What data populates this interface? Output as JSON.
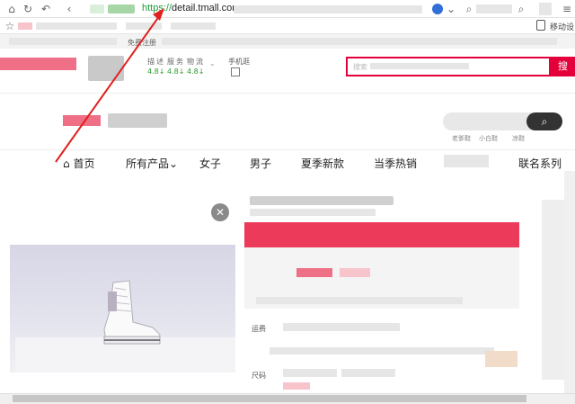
{
  "browser": {
    "url_scheme": "https://",
    "url_host": "detail.tmall.com",
    "bookmark_text": "免费注册",
    "mobile_device_label": "移动设构"
  },
  "header": {
    "rating_labels": [
      "描",
      "述",
      "服",
      "务",
      "物",
      "流"
    ],
    "ratings": [
      "4.8↓",
      "4.8↓",
      "4.8↓"
    ],
    "mobile_store_label": "手机逛",
    "search_placeholder": "搜索",
    "search_button": "搜"
  },
  "store": {
    "links": [
      "老爹鞋",
      "小白鞋",
      "凉鞋"
    ]
  },
  "nav": {
    "home": "首页",
    "all_products": "所有产品",
    "women": "女子",
    "men": "男子",
    "summer_new": "夏季新款",
    "hot_season": "当季热销",
    "collab": "联名系列"
  },
  "product": {
    "attr_shipping": "运费",
    "attr_size": "尺码"
  },
  "colors": {
    "tmall_red": "#e4003a",
    "url_green": "#1a9c3a",
    "arrow_red": "#e02020"
  }
}
